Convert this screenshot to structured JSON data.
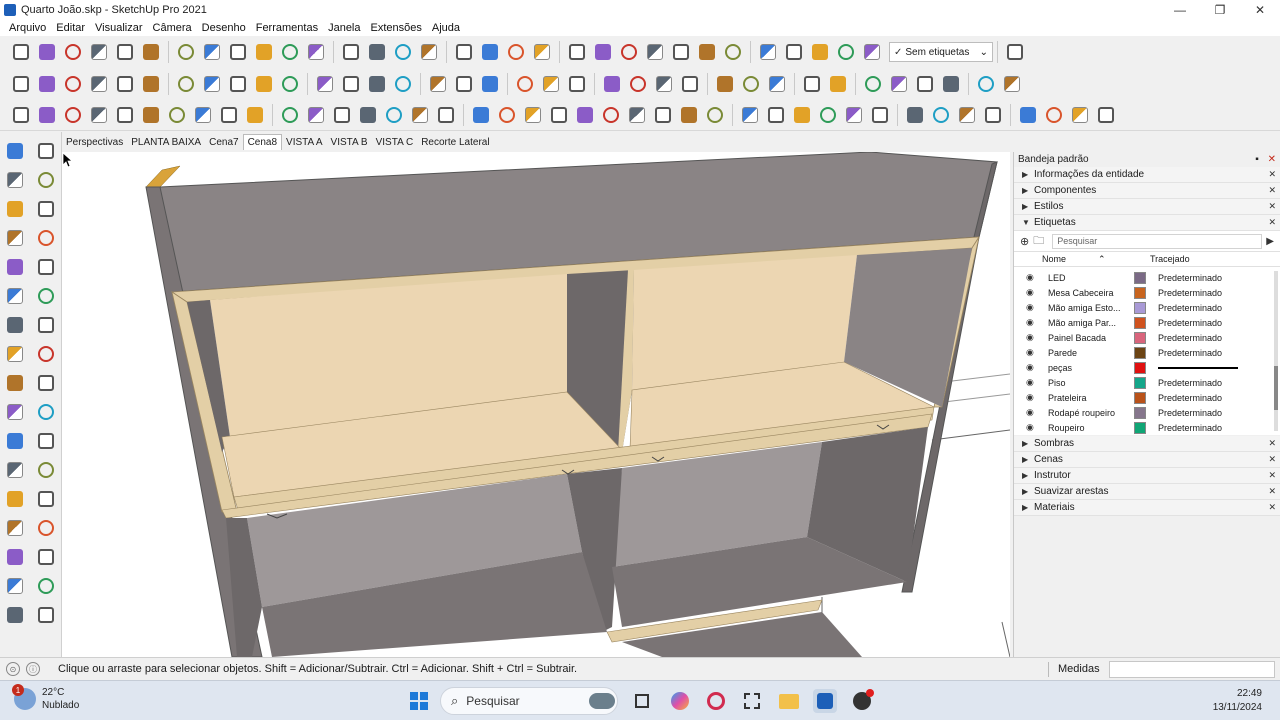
{
  "titlebar": {
    "title": "Quarto João.skp - SketchUp Pro 2021",
    "minimize": "—",
    "restore": "❐",
    "close": "✕"
  },
  "menu": [
    "Arquivo",
    "Editar",
    "Visualizar",
    "Câmera",
    "Desenho",
    "Ferramentas",
    "Janela",
    "Extensões",
    "Ajuda"
  ],
  "toolbar": {
    "tag_dropdown_label": "Sem etiquetas",
    "tag_dropdown_check": "✓",
    "tag_dropdown_caret": "⌄"
  },
  "scenes": [
    "Perspectivas",
    "PLANTA BAIXA",
    "Cena7",
    "Cena8",
    "VISTA A",
    "VISTA B",
    "VISTA C",
    "Recorte Lateral"
  ],
  "active_scene_index": 3,
  "tray": {
    "title": "Bandeja padrão",
    "pin": "▪",
    "close": "✕",
    "panels_top": [
      {
        "label": "Informações da entidade",
        "expanded": false
      },
      {
        "label": "Componentes",
        "expanded": false
      },
      {
        "label": "Estilos",
        "expanded": false
      },
      {
        "label": "Etiquetas",
        "expanded": true
      }
    ],
    "tags": {
      "search_placeholder": "Pesquisar",
      "col_name": "Nome",
      "col_sort": "⌃",
      "col_dash": "Tracejado",
      "rows": [
        {
          "name": "LED",
          "color": "#7b6a86",
          "dash": "Predeterminado"
        },
        {
          "name": "Mesa Cabeceira",
          "color": "#c8641e",
          "dash": "Predeterminado"
        },
        {
          "name": "Mão amiga Esto...",
          "color": "#a99ad6",
          "dash": "Predeterminado"
        },
        {
          "name": "Mão amiga Par...",
          "color": "#d0521e",
          "dash": "Predeterminado"
        },
        {
          "name": "Painel Bacada",
          "color": "#d9657c",
          "dash": "Predeterminado"
        },
        {
          "name": "Parede",
          "color": "#6b4414",
          "dash": "Predeterminado"
        },
        {
          "name": "peças",
          "color": "#e01010",
          "dash": ""
        },
        {
          "name": "Piso",
          "color": "#14a68a",
          "dash": "Predeterminado"
        },
        {
          "name": "Prateleira",
          "color": "#b9521a",
          "dash": "Predeterminado"
        },
        {
          "name": "Rodapé roupeiro",
          "color": "#86768c",
          "dash": "Predeterminado"
        },
        {
          "name": "Roupeiro",
          "color": "#10a676",
          "dash": "Predeterminado"
        }
      ]
    },
    "panels_bottom": [
      {
        "label": "Sombras"
      },
      {
        "label": "Cenas"
      },
      {
        "label": "Instrutor"
      },
      {
        "label": "Suavizar arestas"
      },
      {
        "label": "Materiais"
      }
    ]
  },
  "status": {
    "message": "Clique ou arraste para selecionar objetos. Shift = Adicionar/Subtrair. Ctrl = Adicionar. Shift + Ctrl = Subtrair.",
    "measure_label": "Medidas",
    "measure_value": ""
  },
  "taskbar": {
    "weather_temp": "22°C",
    "weather_desc": "Nublado",
    "weather_badge": "1",
    "search_label": "Pesquisar",
    "search_icon": "⌕",
    "time": "22:49",
    "date": "13/11/2024"
  },
  "colors": {
    "cabinet_body": "#8a8485",
    "cabinet_dark": "#6d6869",
    "edge_wood": "#e3cfa6",
    "panel_wood": "#ecd6b2",
    "accent_red": "#c42b1c"
  },
  "icons": {
    "toolbar_row1": [
      "select-icon",
      "eraser-icon",
      "pencil-icon",
      "arc-icon",
      "rectangle-icon",
      "push-pull-icon",
      "move-icon",
      "rotate-icon",
      "scale-icon",
      "tape-icon",
      "text-icon",
      "paint-icon",
      "orbit-icon",
      "pan-icon",
      "zoom-icon",
      "zoom-extents-icon",
      "components-icon",
      "styles-icon",
      "layers-icon",
      "sections-icon",
      "user-icon",
      "views-iso-icon",
      "views-top-icon",
      "views-front-icon",
      "views-right-icon",
      "views-back-icon",
      "views-left-icon",
      "section-plane-icon",
      "section-display-icon",
      "section-fill-icon",
      "section-cut-icon",
      "tag-tool-icon",
      "extension-red-icon"
    ],
    "toolbar_row2": [
      "extension-warehouse-icon",
      "settings-gear-icon",
      "furniture-icon",
      "drawer-icon",
      "hardware-icon",
      "cube-icon",
      "cube-outline-icon",
      "box-icon",
      "shape-icon",
      "solid-icon",
      "layer-icon",
      "photo-icon",
      "cut-list-icon",
      "scissors-icon",
      "render-icon",
      "arrow-icon",
      "save-icon",
      "play-icon",
      "target-icon",
      "fit-icon",
      "camera-icon",
      "panel-icon",
      "pipette-icon",
      "orbit-axis-icon",
      "cube-orange-icon",
      "cube-blue-icon",
      "cube-green-icon",
      "mark-icon",
      "layout-icon",
      "lamp-icon",
      "cloud-icon",
      "cloud-red-icon",
      "cloud-swap-icon",
      "cloud-link-icon",
      "color-grid-icon",
      "cursor-x-icon"
    ],
    "toolbar_row3": [
      "sofa-icon",
      "box-lid-icon",
      "sandbox-icon",
      "grass-icon",
      "stamp-icon",
      "drape-icon",
      "grid-icon",
      "flip-icon",
      "array-icon",
      "distribute-icon",
      "bucket-icon",
      "circle-orange-icon",
      "protractor-icon",
      "text-t-icon",
      "axes-icon",
      "dome-icon",
      "dome-outline-icon",
      "layers-front-icon",
      "layers-back-icon",
      "transparency-icon",
      "xray-icon",
      "back-edges-icon",
      "wireframe-icon",
      "hidden-line-icon",
      "shaded-icon",
      "textured-icon",
      "monochrome-icon",
      "pin-icon",
      "shadow-icon",
      "fog-icon",
      "edge-style-icon",
      "profile-icon",
      "extension-a-icon",
      "extension-b-icon",
      "extension-c-icon",
      "extension-d-icon",
      "line-style-icon",
      "window-icon",
      "window-b-icon",
      "window-c-icon",
      "window-d-icon"
    ],
    "left_palette": [
      "select-icon",
      "make-component-icon",
      "paint-bucket-icon",
      "eraser-icon",
      "line-icon",
      "freehand-icon",
      "rectangle-icon",
      "rotated-rectangle-icon",
      "circle-icon",
      "polygon-icon",
      "arc-icon",
      "arc-2pt-icon",
      "arc-3pt-icon",
      "pie-icon",
      "move-icon",
      "push-pull-icon",
      "rotate-icon",
      "follow-me-icon",
      "scale-icon",
      "offset-icon",
      "tape-measure-icon",
      "dimension-icon",
      "protractor-icon",
      "text-icon",
      "axes-icon",
      "3d-text-icon",
      "orbit-icon",
      "pan-icon",
      "zoom-icon",
      "zoom-window-icon",
      "zoom-extents-icon",
      "previous-view-icon",
      "position-camera-icon",
      "look-around-icon"
    ]
  }
}
